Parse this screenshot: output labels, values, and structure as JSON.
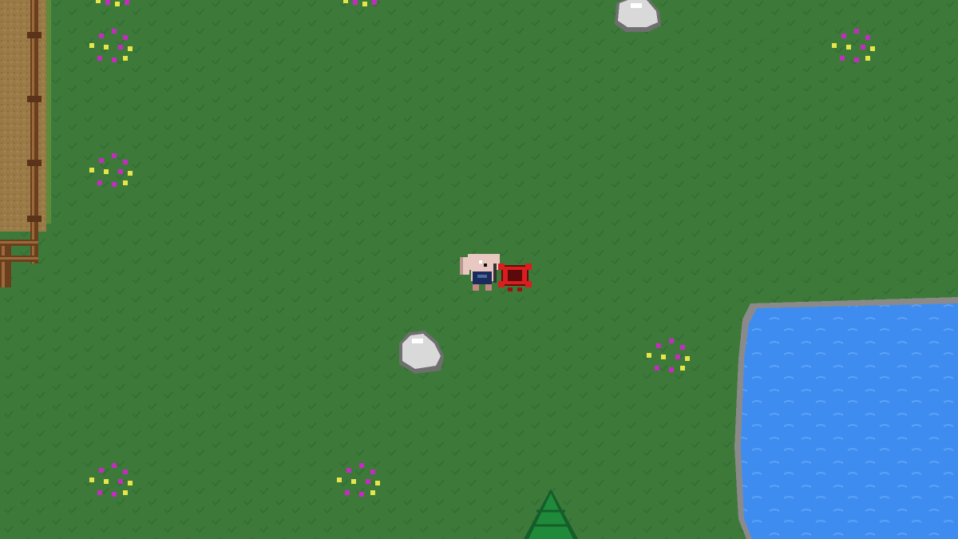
{
  "scene": {
    "view": "top-down",
    "terrain": "grass",
    "colors": {
      "grass": "#3d7a3a",
      "grass_tuft": "#2f6a30",
      "dirt": "#9a7b47",
      "dirt_dark": "#8a6b3a",
      "fence": "#6b3f1e",
      "fence_highlight": "#9a6a3a",
      "water": "#3f8cf0",
      "water_shore": "#8a8a8a",
      "rock": "#d9d9d9",
      "rock_shadow": "#7a7a7a",
      "flower_magenta": "#c42cc0",
      "flower_yellow": "#e6e64a",
      "pine": "#1f8a3a",
      "player_fur": "#e8c8c0",
      "player_outfit": "#1a2a5a",
      "pet": "#d81e1e"
    }
  },
  "entities": {
    "player": {
      "name": "bunny-player",
      "icon": "bunny-character"
    },
    "companion": {
      "name": "red-crab-companion",
      "icon": "crab-icon"
    },
    "rocks": [
      "boulder",
      "boulder"
    ],
    "flower_patches": 8,
    "trees": [
      "pine-tree"
    ],
    "water": "pond",
    "fence": "wooden-fence",
    "path": "dirt-path"
  }
}
